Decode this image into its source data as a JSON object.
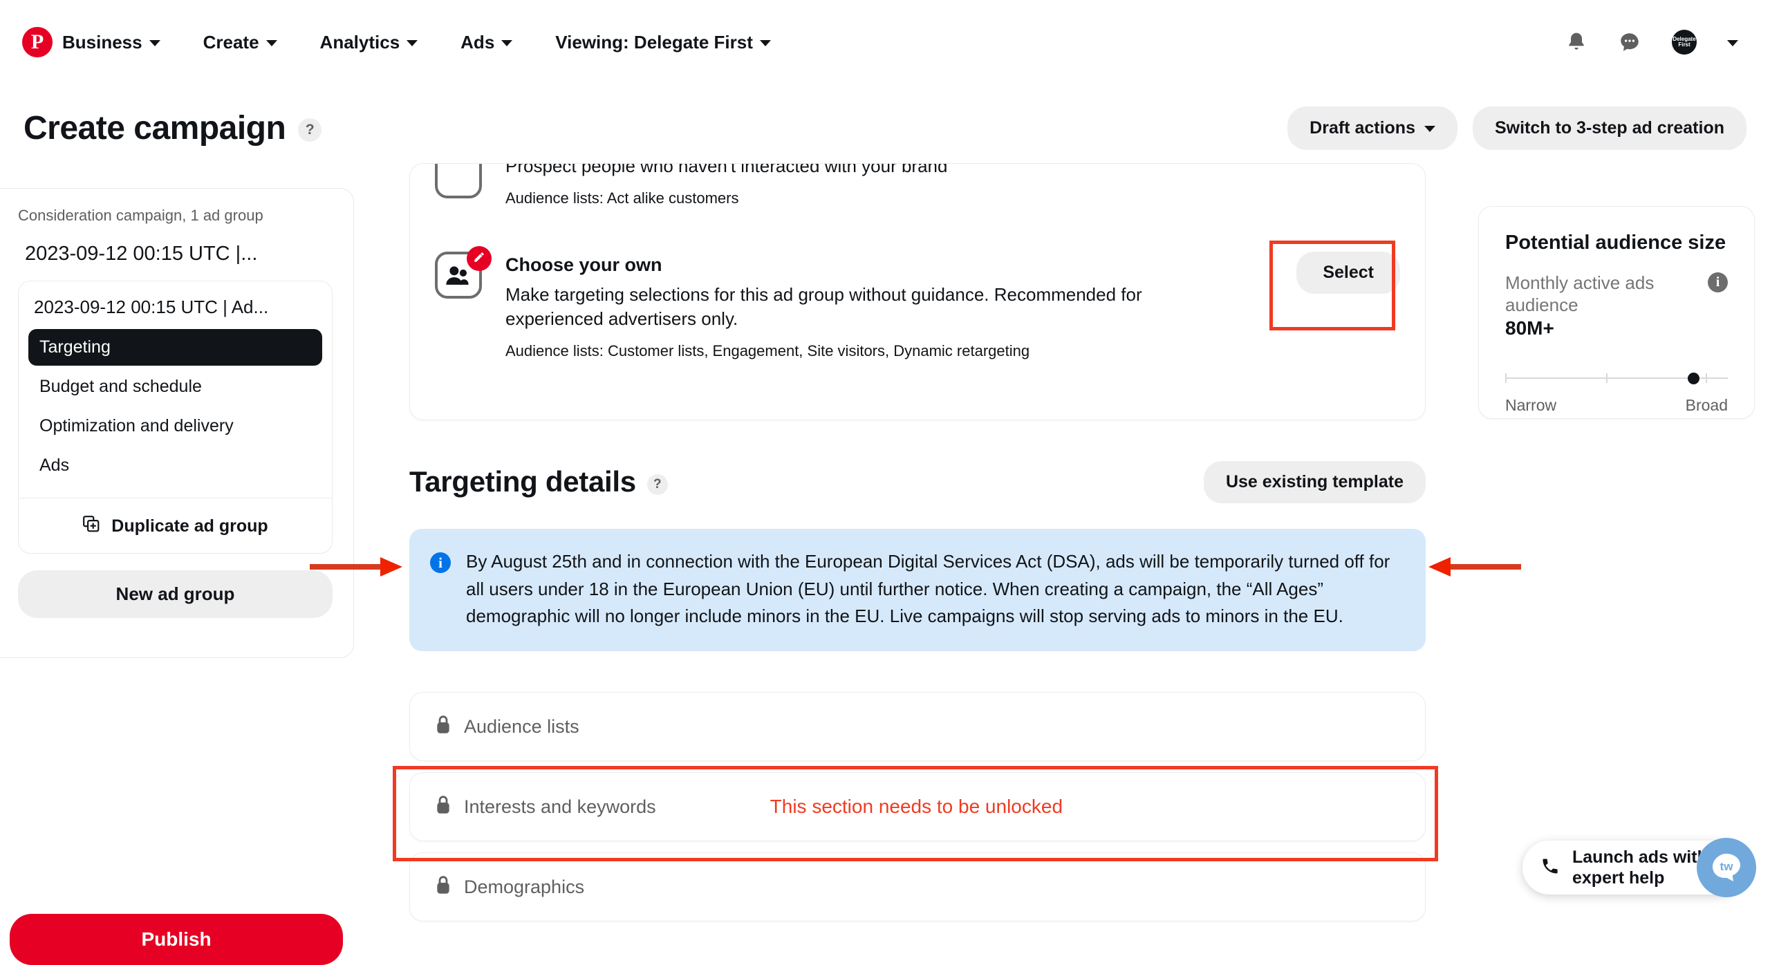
{
  "nav": {
    "logo_icon": "pinterest-logo-icon",
    "items": [
      {
        "label": "Business",
        "caret": true
      },
      {
        "label": "Create",
        "caret": true
      },
      {
        "label": "Analytics",
        "caret": true
      },
      {
        "label": "Ads",
        "caret": true
      },
      {
        "label": "Viewing: Delegate First",
        "caret": true
      }
    ],
    "right": {
      "bell_icon": "notifications-bell-icon",
      "messages_icon": "messages-bubble-icon",
      "avatar_text": "Delegate First",
      "caret_icon": "chevron-down-icon"
    }
  },
  "header": {
    "title": "Create campaign",
    "help_label": "?",
    "draft_actions": "Draft actions",
    "switch_mode": "Switch to 3-step ad creation"
  },
  "sidebar": {
    "campaign_summary": "Consideration campaign, 1 ad group",
    "campaign_name": "2023-09-12 00:15 UTC |...",
    "ad_group": {
      "name": "2023-09-12 00:15 UTC | Ad...",
      "items": [
        {
          "label": "Targeting",
          "active": true
        },
        {
          "label": "Budget and schedule",
          "active": false
        },
        {
          "label": "Optimization and delivery",
          "active": false
        },
        {
          "label": "Ads",
          "active": false
        }
      ],
      "duplicate_label": "Duplicate ad group",
      "duplicate_icon": "duplicate-icon"
    },
    "new_ad_group": "New ad group",
    "publish": "Publish"
  },
  "targeting_options": {
    "partial_option": {
      "desc": "Prospect people who haven't interacted with your brand",
      "meta": "Audience lists: Act alike customers"
    },
    "choose_own": {
      "title": "Choose your own",
      "desc": "Make targeting selections for this ad group without guidance. Recommended for experienced advertisers only.",
      "meta": "Audience lists: Customer lists, Engagement, Site visitors, Dynamic retargeting",
      "icon": "people-edit-icon",
      "badge_icon": "pencil-icon",
      "select_label": "Select"
    }
  },
  "targeting_details": {
    "title": "Targeting details",
    "help_label": "?",
    "use_template": "Use existing template",
    "dsa_notice": "By August 25th and in connection with the European Digital Services Act (DSA), ads will be temporarily turned off for all users under 18 in the European Union (EU) until further notice. When creating a campaign, the “All Ages” demographic will no longer include minors in the EU. Live campaigns will stop serving ads to minors in the EU.",
    "info_icon": "info-icon",
    "sections": [
      {
        "label": "Audience lists",
        "locked": true,
        "lock_icon": "lock-icon",
        "warning": ""
      },
      {
        "label": "Interests and keywords",
        "locked": true,
        "lock_icon": "lock-icon",
        "warning": "This section needs to be unlocked"
      },
      {
        "label": "Demographics",
        "locked": true,
        "lock_icon": "lock-icon",
        "warning": ""
      }
    ]
  },
  "audience_panel": {
    "title": "Potential audience size",
    "subtitle": "Monthly active ads audience",
    "value": "80M+",
    "info_icon": "info-icon",
    "narrow_label": "Narrow",
    "broad_label": "Broad"
  },
  "help_widget": {
    "line1": "Launch ads with",
    "line2": "expert help",
    "phone_icon": "phone-icon",
    "avatar_label": "tw"
  },
  "annotations": {
    "highlight_color": "#ef3b23",
    "arrow_left": "arrow-right-pointer",
    "arrow_right": "arrow-left-pointer"
  }
}
